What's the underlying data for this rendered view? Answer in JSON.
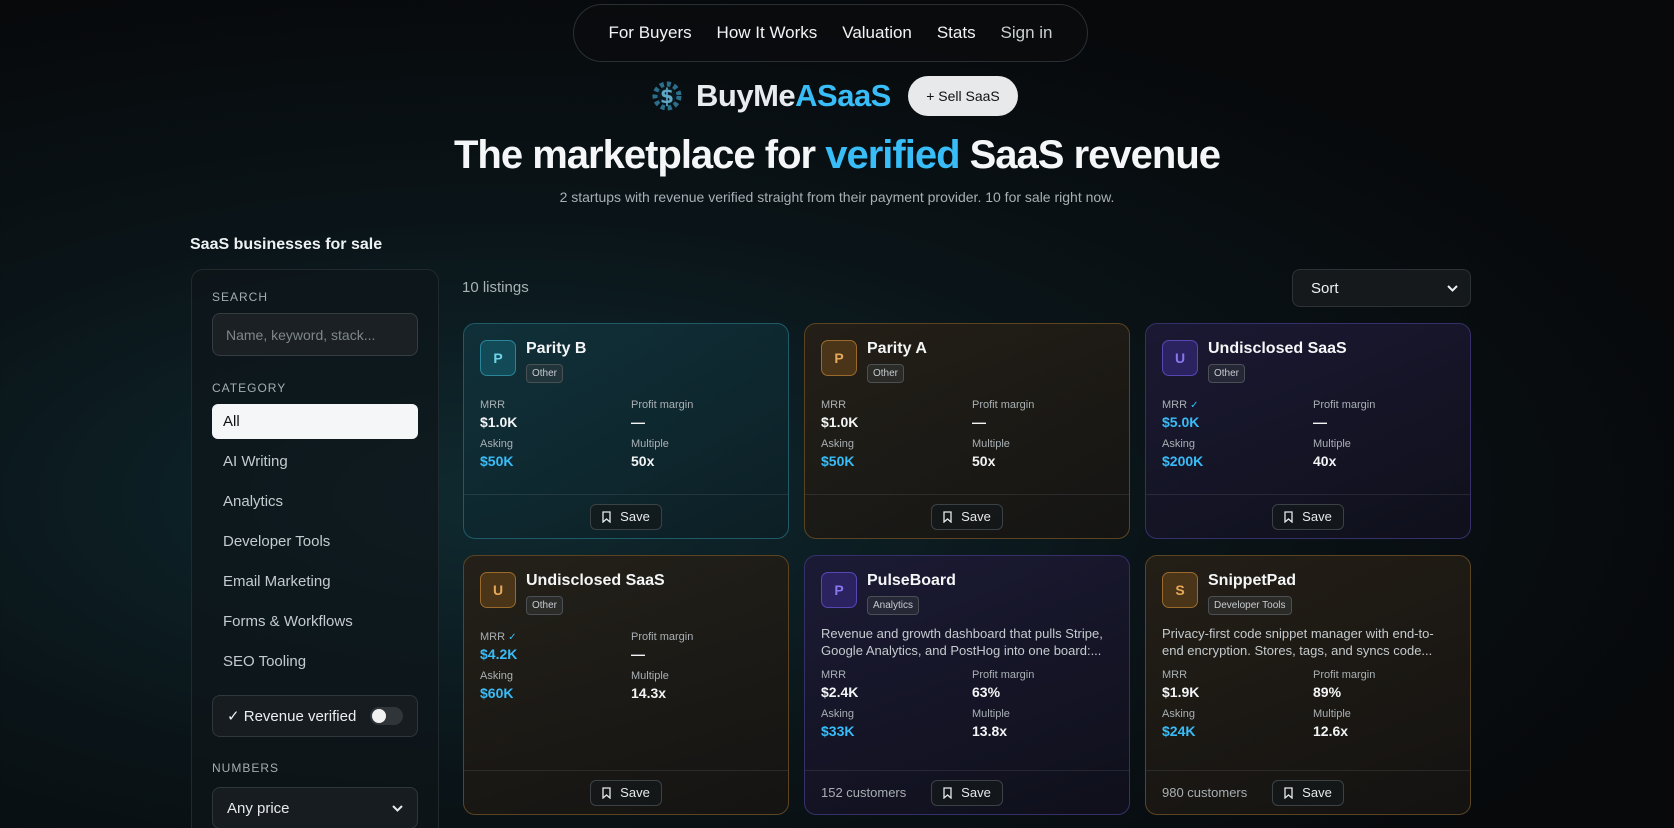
{
  "nav": {
    "items": [
      "For Buyers",
      "How It Works",
      "Valuation",
      "Stats"
    ],
    "signin": "Sign in"
  },
  "brand": {
    "name_part1": "BuyMe",
    "name_part2": "ASaaS",
    "sell_button": "+ Sell SaaS",
    "accent_color": "#38bdf8"
  },
  "hero": {
    "title_pre": "The marketplace for ",
    "title_highlight": "verified",
    "title_post": " SaaS revenue",
    "subtitle": "2 startups with revenue verified straight from their payment provider. 10 for sale right now."
  },
  "section_title": "SaaS businesses for sale",
  "sidebar": {
    "search_label": "SEARCH",
    "search_placeholder": "Name, keyword, stack...",
    "category_label": "CATEGORY",
    "categories": [
      "All",
      "AI Writing",
      "Analytics",
      "Developer Tools",
      "Email Marketing",
      "Forms & Workflows",
      "SEO Tooling"
    ],
    "active_category": "All",
    "revenue_verified_label": "✓ Revenue verified",
    "revenue_verified_on": false,
    "numbers_label": "NUMBERS",
    "price_select": "Any price"
  },
  "listings": {
    "count_label": "10 listings",
    "sort_label": "Sort",
    "cards": [
      {
        "avatar": "P",
        "theme": "teal",
        "name": "Parity B",
        "tag": "Other",
        "description": "",
        "mrr_label": "MRR",
        "mrr_verified": false,
        "mrr": "$1.0K",
        "mrr_blue": false,
        "profit_label": "Profit margin",
        "profit": "—",
        "asking_label": "Asking",
        "asking": "$50K",
        "multiple_label": "Multiple",
        "multiple": "50x",
        "customers": "",
        "save": "Save"
      },
      {
        "avatar": "P",
        "theme": "amber",
        "name": "Parity A",
        "tag": "Other",
        "description": "",
        "mrr_label": "MRR",
        "mrr_verified": false,
        "mrr": "$1.0K",
        "mrr_blue": false,
        "profit_label": "Profit margin",
        "profit": "—",
        "asking_label": "Asking",
        "asking": "$50K",
        "multiple_label": "Multiple",
        "multiple": "50x",
        "customers": "",
        "save": "Save"
      },
      {
        "avatar": "U",
        "theme": "violet",
        "name": "Undisclosed SaaS",
        "tag": "Other",
        "description": "",
        "mrr_label": "MRR",
        "mrr_verified": true,
        "mrr": "$5.0K",
        "mrr_blue": true,
        "profit_label": "Profit margin",
        "profit": "—",
        "asking_label": "Asking",
        "asking": "$200K",
        "multiple_label": "Multiple",
        "multiple": "40x",
        "customers": "",
        "save": "Save"
      },
      {
        "avatar": "U",
        "theme": "amber",
        "name": "Undisclosed SaaS",
        "tag": "Other",
        "description": "",
        "mrr_label": "MRR",
        "mrr_verified": true,
        "mrr": "$4.2K",
        "mrr_blue": true,
        "profit_label": "Profit margin",
        "profit": "—",
        "asking_label": "Asking",
        "asking": "$60K",
        "multiple_label": "Multiple",
        "multiple": "14.3x",
        "customers": "",
        "save": "Save"
      },
      {
        "avatar": "P",
        "theme": "violet",
        "name": "PulseBoard",
        "tag": "Analytics",
        "description": "Revenue and growth dashboard that pulls Stripe, Google Analytics, and PostHog into one board:...",
        "mrr_label": "MRR",
        "mrr_verified": false,
        "mrr": "$2.4K",
        "mrr_blue": false,
        "profit_label": "Profit margin",
        "profit": "63%",
        "asking_label": "Asking",
        "asking": "$33K",
        "multiple_label": "Multiple",
        "multiple": "13.8x",
        "customers": "152 customers",
        "save": "Save"
      },
      {
        "avatar": "S",
        "theme": "amber",
        "name": "SnippetPad",
        "tag": "Developer Tools",
        "description": "Privacy-first code snippet manager with end-to-end encryption. Stores, tags, and syncs code...",
        "mrr_label": "MRR",
        "mrr_verified": false,
        "mrr": "$1.9K",
        "mrr_blue": false,
        "profit_label": "Profit margin",
        "profit": "89%",
        "asking_label": "Asking",
        "asking": "$24K",
        "multiple_label": "Multiple",
        "multiple": "12.6x",
        "customers": "980 customers",
        "save": "Save"
      }
    ]
  }
}
